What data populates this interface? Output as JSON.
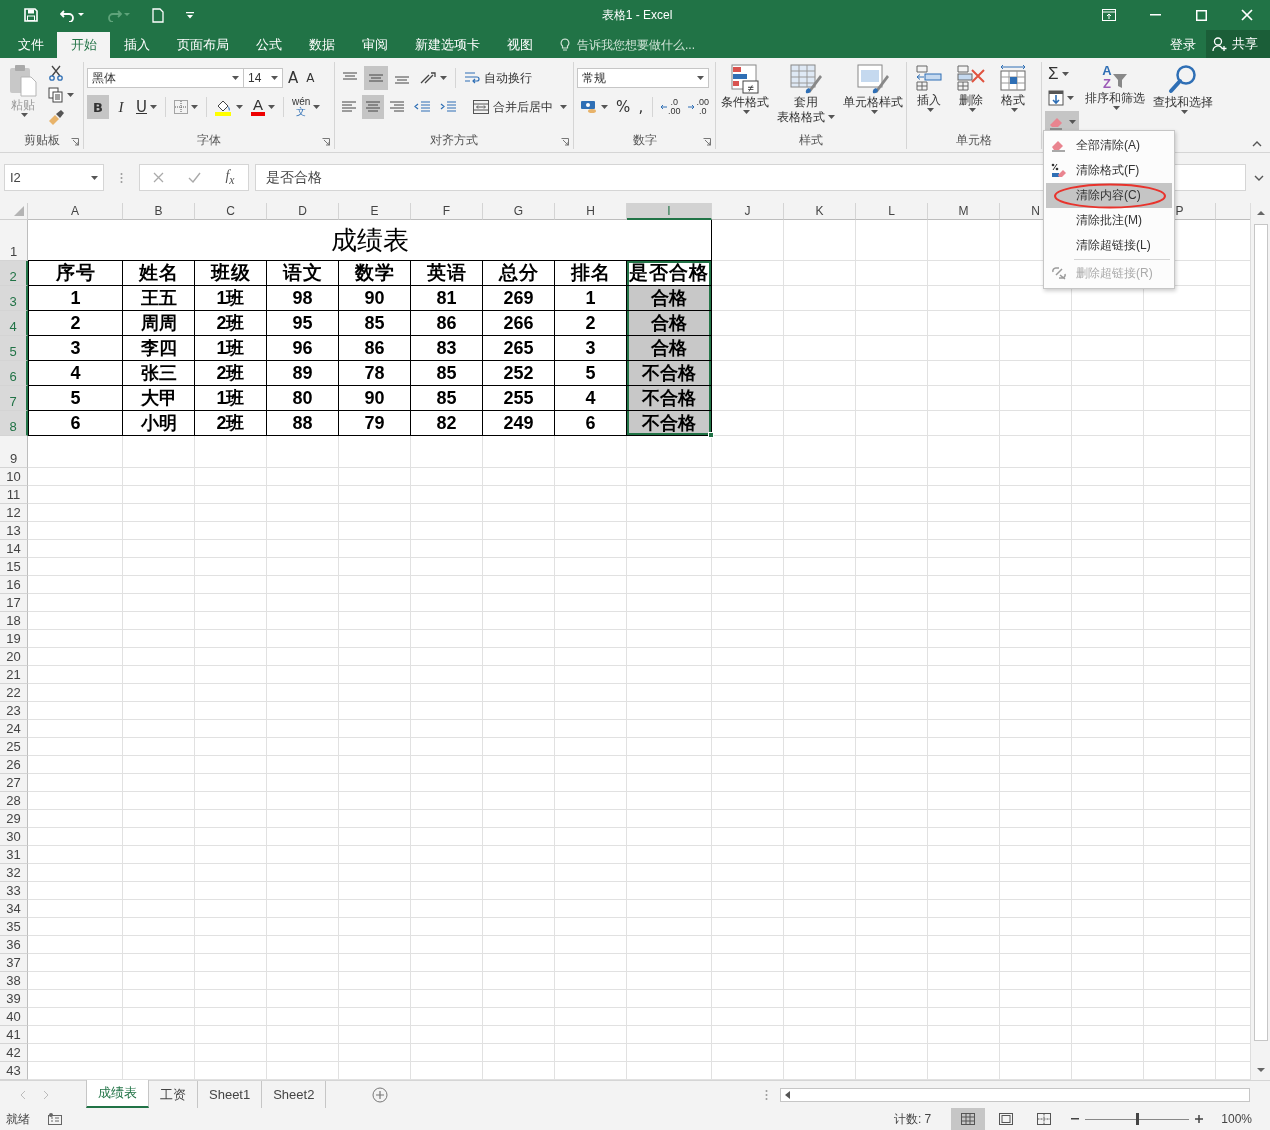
{
  "window": {
    "title": "表格1 - Excel"
  },
  "tabs": [
    {
      "label": "文件",
      "selected": false
    },
    {
      "label": "开始",
      "selected": true
    },
    {
      "label": "插入",
      "selected": false
    },
    {
      "label": "页面布局",
      "selected": false
    },
    {
      "label": "公式",
      "selected": false
    },
    {
      "label": "数据",
      "selected": false
    },
    {
      "label": "审阅",
      "selected": false
    },
    {
      "label": "新建选项卡",
      "selected": false
    },
    {
      "label": "视图",
      "selected": false
    }
  ],
  "tell_me": {
    "placeholder": "告诉我您想要做什么..."
  },
  "account": {
    "sign_in": "登录",
    "share": "共享"
  },
  "ribbon": {
    "clipboard": {
      "paste": "粘贴",
      "label": "剪贴板"
    },
    "font": {
      "name": "黑体",
      "size": "14",
      "grow": "A",
      "shrink": "A",
      "bold": "B",
      "italic": "I",
      "underline": "U",
      "font_color": "A",
      "phonetic": "wén",
      "phonetic_char": "文",
      "bold_on": true,
      "label": "字体"
    },
    "alignment": {
      "vertical": [
        {
          "selected": false
        },
        {
          "selected": true
        },
        {
          "selected": false
        }
      ],
      "horizontal": [
        {
          "selected": false
        },
        {
          "selected": true
        },
        {
          "selected": false
        }
      ],
      "wrap": "自动换行",
      "merge": "合并后居中",
      "label": "对齐方式"
    },
    "number": {
      "format": "常规",
      "percent": "%",
      "comma": ",",
      "increase": [
        ".0",
        ".00"
      ],
      "decrease": [
        ".00",
        ".0"
      ],
      "label": "数字"
    },
    "styles": {
      "conditional": "条件格式",
      "not_equal": "≠",
      "table_format": [
        "套用",
        "表格格式"
      ],
      "cell_styles": "单元格样式",
      "label": "样式"
    },
    "cells": {
      "insert": "插入",
      "delete": "删除",
      "format": "格式",
      "label": "单元格"
    },
    "editing": {
      "sum": "Σ",
      "sort_letters": [
        "A",
        "Z"
      ],
      "sort": "排序和筛选",
      "find": "查找和选择"
    }
  },
  "clear_menu": {
    "open": true,
    "items": [
      {
        "label": "全部清除(A)",
        "kind": "eraser",
        "selected": false,
        "disabled": false,
        "circled": false
      },
      {
        "label": "清除格式(F)",
        "kind": "format",
        "selected": false,
        "disabled": false,
        "circled": false
      },
      {
        "label": "清除内容(C)",
        "kind": "none",
        "selected": true,
        "disabled": false,
        "circled": true
      },
      {
        "label": "清除批注(M)",
        "kind": "none",
        "selected": false,
        "disabled": false,
        "circled": false
      },
      {
        "label": "清除超链接(L)",
        "kind": "none",
        "selected": false,
        "disabled": false,
        "circled": false
      },
      {
        "label": "删除超链接(R)",
        "kind": "unlink",
        "selected": false,
        "disabled": true,
        "circled": false
      }
    ]
  },
  "formula_bar": {
    "name_box": "I2",
    "fx": "f$_{x}$",
    "content": "是否合格"
  },
  "sheet": {
    "columns": [
      {
        "label": "A",
        "selected": false
      },
      {
        "label": "B",
        "selected": false
      },
      {
        "label": "C",
        "selected": false
      },
      {
        "label": "D",
        "selected": false
      },
      {
        "label": "E",
        "selected": false
      },
      {
        "label": "F",
        "selected": false
      },
      {
        "label": "G",
        "selected": false
      },
      {
        "label": "H",
        "selected": false
      },
      {
        "label": "I",
        "selected": true
      },
      {
        "label": "J",
        "selected": false
      },
      {
        "label": "K",
        "selected": false
      },
      {
        "label": "L",
        "selected": false
      },
      {
        "label": "M",
        "selected": false
      },
      {
        "label": "N",
        "selected": false
      },
      {},
      {
        "label": "P",
        "selected": false
      }
    ],
    "row_headers": [
      {
        "label": "1",
        "selected": false
      },
      {
        "label": "2",
        "selected": true
      },
      {
        "label": "3",
        "selected": true
      },
      {
        "label": "4",
        "selected": true
      },
      {
        "label": "5",
        "selected": true
      },
      {
        "label": "6",
        "selected": true
      },
      {
        "label": "7",
        "selected": true
      },
      {
        "label": "8",
        "selected": true
      },
      {
        "label": "9",
        "selected": false
      },
      {
        "label": "10",
        "selected": false
      },
      {
        "label": "11",
        "selected": false
      },
      {
        "label": "12",
        "selected": false
      },
      {
        "label": "13",
        "selected": false
      },
      {
        "label": "14",
        "selected": false
      },
      {
        "label": "15",
        "selected": false
      },
      {
        "label": "16",
        "selected": false
      },
      {
        "label": "17",
        "selected": false
      },
      {
        "label": "18",
        "selected": false
      },
      {
        "label": "19",
        "selected": false
      },
      {
        "label": "20",
        "selected": false
      },
      {
        "label": "21",
        "selected": false
      },
      {
        "label": "22",
        "selected": false
      },
      {
        "label": "23",
        "selected": false
      },
      {
        "label": "24",
        "selected": false
      },
      {
        "label": "25",
        "selected": false
      },
      {
        "label": "26",
        "selected": false
      },
      {
        "label": "27",
        "selected": false
      },
      {
        "label": "28",
        "selected": false
      },
      {
        "label": "29",
        "selected": false
      },
      {
        "label": "30",
        "selected": false
      },
      {
        "label": "31",
        "selected": false
      },
      {
        "label": "32",
        "selected": false
      },
      {
        "label": "33",
        "selected": false
      },
      {
        "label": "34",
        "selected": false
      },
      {
        "label": "35",
        "selected": false
      },
      {
        "label": "36",
        "selected": false
      },
      {
        "label": "37",
        "selected": false
      },
      {
        "label": "38",
        "selected": false
      },
      {
        "label": "39",
        "selected": false
      },
      {
        "label": "40",
        "selected": false
      },
      {
        "label": "41",
        "selected": false
      },
      {
        "label": "42",
        "selected": false
      },
      {
        "label": "43",
        "selected": false
      }
    ],
    "title": "成绩表",
    "table": {
      "header": [
        "序号",
        "姓名",
        "班级",
        "语文",
        "数学",
        "英语",
        "总分",
        "排名",
        "是否合格"
      ],
      "rows": [
        [
          "1",
          "王五",
          "1班",
          "98",
          "90",
          "81",
          "269",
          "1",
          "合格"
        ],
        [
          "2",
          "周周",
          "2班",
          "95",
          "85",
          "86",
          "266",
          "2",
          "合格"
        ],
        [
          "3",
          "李四",
          "1班",
          "96",
          "86",
          "83",
          "265",
          "3",
          "合格"
        ],
        [
          "4",
          "张三",
          "2班",
          "89",
          "78",
          "85",
          "252",
          "5",
          "不合格"
        ],
        [
          "5",
          "大甲",
          "1班",
          "80",
          "90",
          "85",
          "255",
          "4",
          "不合格"
        ],
        [
          "6",
          "小明",
          "2班",
          "88",
          "79",
          "82",
          "249",
          "6",
          "不合格"
        ]
      ]
    }
  },
  "sheet_tabs": [
    {
      "label": "成绩表",
      "selected": true
    },
    {
      "label": "工资",
      "selected": false
    },
    {
      "label": "Sheet1",
      "selected": false
    },
    {
      "label": "Sheet2",
      "selected": false
    }
  ],
  "status_bar": {
    "ready": "就绪",
    "count": "计数: 7",
    "views": [
      {
        "selected": true
      },
      {
        "selected": false
      },
      {
        "selected": false
      }
    ],
    "zoom": {
      "level": 0.5,
      "reading": "100%"
    }
  }
}
